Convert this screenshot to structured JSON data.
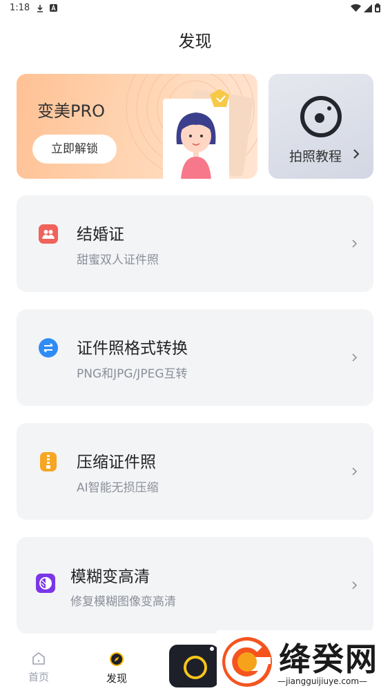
{
  "status_bar": {
    "time": "1:18"
  },
  "page": {
    "title": "发现"
  },
  "banners": {
    "pro": {
      "title": "变美PRO",
      "button_label": "立即解锁"
    },
    "tutorial": {
      "label": "拍照教程",
      "chevron": "›"
    }
  },
  "cards": [
    {
      "title": "结婚证",
      "subtitle": "甜蜜双人证件照",
      "icon": "couple-icon",
      "color": "#f0625a"
    },
    {
      "title": "证件照格式转换",
      "subtitle": "PNG和JPG/JPEG互转",
      "icon": "convert-icon",
      "color": "#2f8cf5"
    },
    {
      "title": "压缩证件照",
      "subtitle": "AI智能无损压缩",
      "icon": "zip-icon",
      "color": "#f5a623"
    },
    {
      "title": "模糊变高清",
      "subtitle": "修复模糊图像变高清",
      "icon": "enhance-icon",
      "color": "#7b36e8"
    }
  ],
  "tab_bar": {
    "home_label": "首页",
    "discover_label": "发现"
  },
  "watermark": {
    "name": "绛癸网",
    "url": "jiangguijiuye.com"
  },
  "colors": {
    "pro_banner": "#ffc194",
    "card_bg": "#f3f4f6",
    "subtitle": "#8b8f99",
    "discover_active": "#f7b500"
  }
}
